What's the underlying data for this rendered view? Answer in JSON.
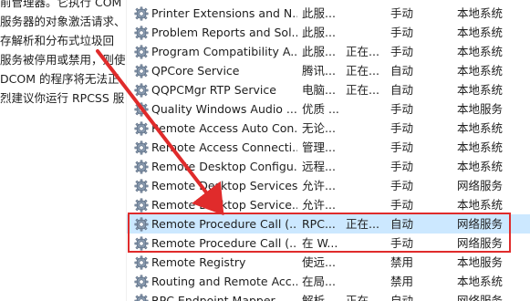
{
  "description_lines": [
    "前管理器。它执行 COM",
    "服务器的对象激活请求、",
    "存解析和分布式垃圾回",
    "服务被停用或禁用，则使",
    " DCOM 的程序将无法正",
    "烈建议你运行 RPCSS 服"
  ],
  "services": [
    {
      "name": "Printer Extensions and N...",
      "description": "此服...",
      "status": "",
      "startup": "手动",
      "logon": "本地系统"
    },
    {
      "name": "Problem Reports and Sol...",
      "description": "此服...",
      "status": "",
      "startup": "手动",
      "logon": "本地系统"
    },
    {
      "name": "Program Compatibility A...",
      "description": "此服...",
      "status": "正在...",
      "startup": "手动",
      "logon": "本地系统"
    },
    {
      "name": "QPCore Service",
      "description": "腾讯...",
      "status": "正在...",
      "startup": "自动",
      "logon": "本地系统"
    },
    {
      "name": "QQPCMgr RTP Service",
      "description": "电脑...",
      "status": "正在...",
      "startup": "自动",
      "logon": "本地系统"
    },
    {
      "name": "Quality Windows Audio ...",
      "description": "优质 ...",
      "status": "",
      "startup": "手动",
      "logon": "本地服务"
    },
    {
      "name": "Remote Access Auto Con...",
      "description": "无论...",
      "status": "",
      "startup": "手动",
      "logon": "本地系统"
    },
    {
      "name": "Remote Access Connecti...",
      "description": "管理...",
      "status": "",
      "startup": "手动",
      "logon": "本地系统"
    },
    {
      "name": "Remote Desktop Configu...",
      "description": "远程...",
      "status": "",
      "startup": "手动",
      "logon": "本地系统"
    },
    {
      "name": "Remote Desktop Services",
      "description": "允许...",
      "status": "",
      "startup": "手动",
      "logon": "网络服务"
    },
    {
      "name": "Remote Desktop Service...",
      "description": "允许...",
      "status": "",
      "startup": "手动",
      "logon": "本地系统"
    },
    {
      "name": "Remote Procedure Call (...",
      "description": "RPC...",
      "status": "正在...",
      "startup": "自动",
      "logon": "网络服务"
    },
    {
      "name": "Remote Procedure Call (...",
      "description": "在 W...",
      "status": "",
      "startup": "手动",
      "logon": "网络服务"
    },
    {
      "name": "Remote Registry",
      "description": "使远...",
      "status": "",
      "startup": "禁用",
      "logon": "本地服务"
    },
    {
      "name": "Routing and Remote Acc...",
      "description": "在局...",
      "status": "",
      "startup": "禁用",
      "logon": "本地系统"
    },
    {
      "name": "RPC Endpoint Mapper",
      "description": "解析...",
      "status": "正在...",
      "startup": "自动",
      "logon": "网络服务"
    }
  ],
  "selected_index": 11,
  "colors": {
    "annotation_red": "#e02b2b",
    "selection_blue": "#cce8ff"
  }
}
